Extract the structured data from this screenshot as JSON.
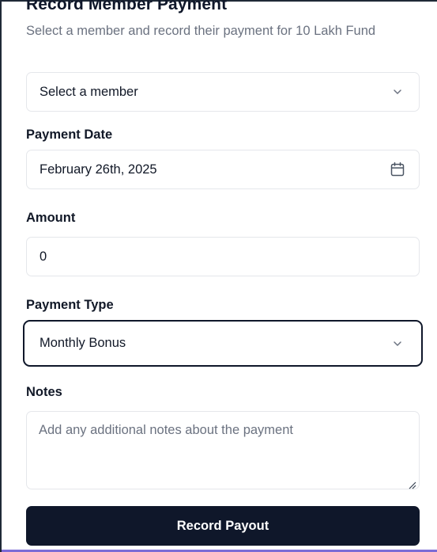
{
  "dialog": {
    "title": "Record Member Payment",
    "subtitle": "Select a member and record their payment for 10 Lakh Fund"
  },
  "member_select": {
    "value": "Select a member",
    "icon": "chevron-down-icon"
  },
  "payment_date": {
    "label": "Payment Date",
    "value": "February 26th, 2025",
    "icon": "calendar-icon"
  },
  "amount": {
    "label": "Amount",
    "value": "0"
  },
  "payment_type": {
    "label": "Payment Type",
    "value": "Monthly Bonus",
    "icon": "chevron-down-icon"
  },
  "notes": {
    "label": "Notes",
    "placeholder": "Add any additional notes about the payment"
  },
  "submit_label": "Record Payout",
  "colors": {
    "primary": "#0f172a",
    "muted_text": "#6b7280",
    "border": "#e5e7eb",
    "bottom_accent": "#7c6bd6"
  }
}
